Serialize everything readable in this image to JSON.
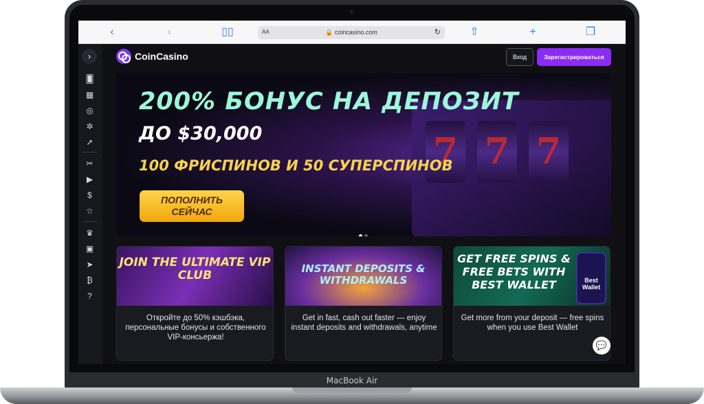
{
  "device": {
    "label": "MacBook Air"
  },
  "browser": {
    "text_size": "AA",
    "url": "coincasino.com"
  },
  "site": {
    "name": "CoinCasino",
    "login_label": "Вход",
    "register_label": "Зарегистрироваться",
    "accent_color": "#8b2cf5"
  },
  "hero": {
    "title": "200% БОНУС НА ДЕПОЗИТ",
    "subtitle": "ДО $30,000",
    "freespins": "100 ФРИСПИНОВ И 50 СУПЕРСПИНОВ",
    "cta": "ПОПОЛНИТЬ СЕЙЧАС",
    "reels": [
      "7",
      "7",
      "7"
    ]
  },
  "promos": [
    {
      "title": "JOIN THE ULTIMATE VIP CLUB",
      "text": "Откройте до 50% кэшбэка, персональные бонусы и собственного VIP-консьержа!"
    },
    {
      "title": "INSTANT DEPOSITS & WITHDRAWALS",
      "text": "Get in fast, cash out faster — enjoy instant deposits and withdrawals, anytime"
    },
    {
      "title": "GET FREE SPINS & FREE BETS WITH BEST WALLET",
      "text": "Get more from your deposit — free spins when you use Best Wallet",
      "badge": "Best Wallet"
    }
  ]
}
